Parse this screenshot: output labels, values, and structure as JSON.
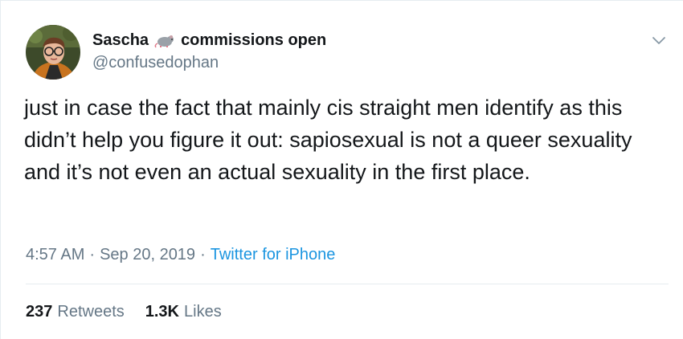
{
  "tweet": {
    "author": {
      "display_name": "Sascha",
      "name_suffix": "commissions open",
      "emoji_icon": "rat-icon",
      "handle": "@confusedophan"
    },
    "text": "just in case the fact that mainly cis straight men identify as this didn’t help you figure it out: sapiosexual is not a queer sexuality and it’s not even an actual sexuality in the first place.",
    "time": "4:57 AM",
    "date": "Sep 20, 2019",
    "separator": "·",
    "source": "Twitter for iPhone",
    "stats": {
      "retweets_count": "237",
      "retweets_label": "Retweets",
      "likes_count": "1.3K",
      "likes_label": "Likes"
    }
  },
  "colors": {
    "text_primary": "#14171a",
    "text_secondary": "#657786",
    "link": "#1b95e0",
    "divider": "#e6ecf0"
  },
  "icons": {
    "more": "chevron-down-icon"
  }
}
